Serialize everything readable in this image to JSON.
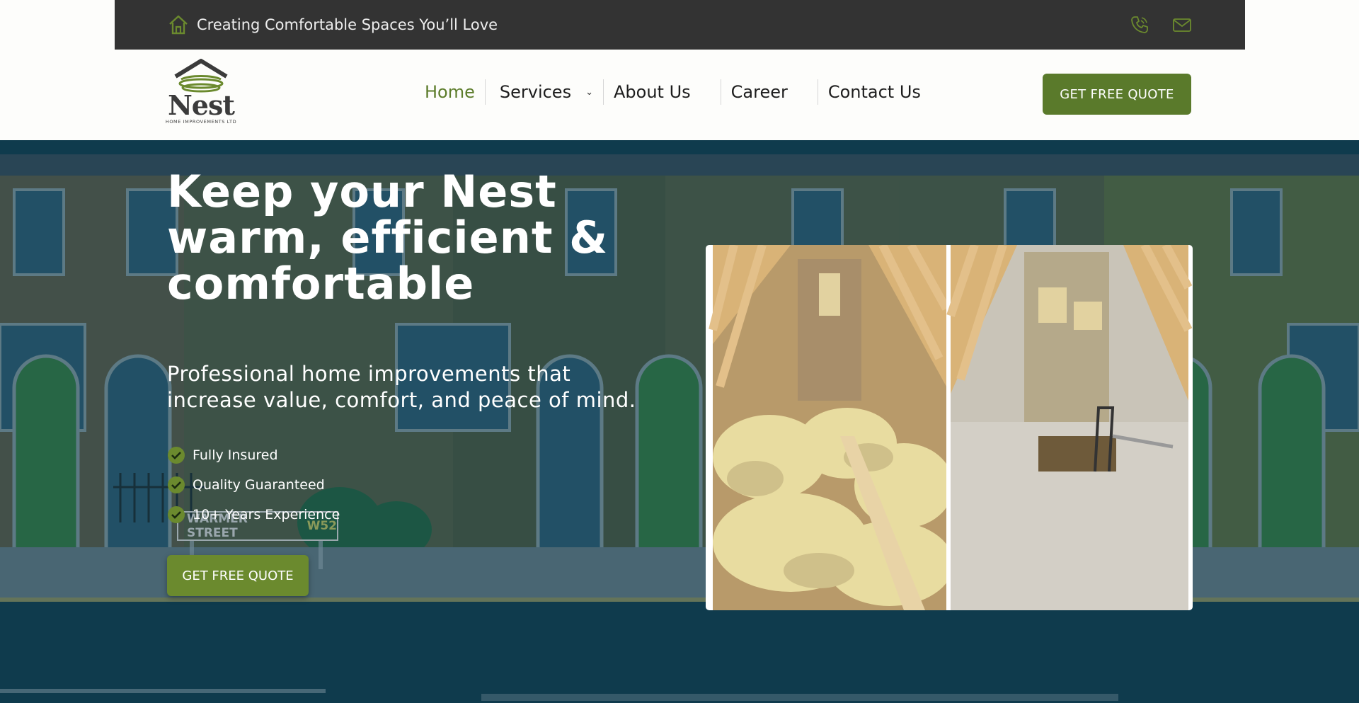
{
  "topbar": {
    "tagline": "Creating Comfortable Spaces You’ll Love",
    "icons": {
      "home": "home-icon",
      "phone": "phone-icon",
      "mail": "mail-icon"
    }
  },
  "header": {
    "logo": {
      "wordmark": "Nest",
      "subtitle": "HOME IMPROVEMENTS LTD"
    },
    "nav": [
      {
        "label": "Home",
        "active": true
      },
      {
        "label": "Services",
        "has_dropdown": true
      },
      {
        "label": "About Us"
      },
      {
        "label": "Career"
      },
      {
        "label": "Contact Us"
      }
    ],
    "cta_label": "GET FREE QUOTE"
  },
  "hero": {
    "title": "Keep your Nest warm, efficient & comfortable",
    "subtitle": "Professional home improvements that increase value, comfort, and peace of mind.",
    "features": [
      "Fully Insured",
      "Quality Guaranteed",
      "10+ Years Experience"
    ],
    "cta_label": "GET FREE QUOTE",
    "street_sign": {
      "name": "WARMER STREET",
      "code": "W52"
    }
  },
  "colors": {
    "brand_green": "#5a7a2b",
    "topbar_bg": "#333333",
    "hero_bg": "#0f3b4d"
  }
}
